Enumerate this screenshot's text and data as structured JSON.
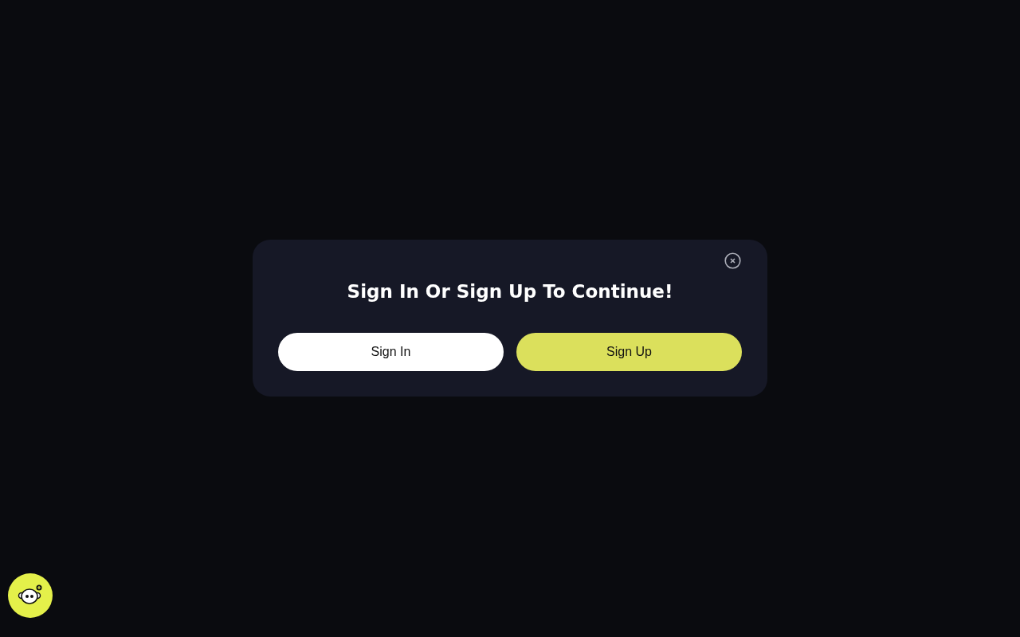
{
  "dialog": {
    "title": "Sign In Or Sign Up To Continue!",
    "buttons": [
      {
        "label": "Sign In",
        "kind": "secondary"
      },
      {
        "label": "Sign Up",
        "kind": "primary"
      }
    ]
  }
}
